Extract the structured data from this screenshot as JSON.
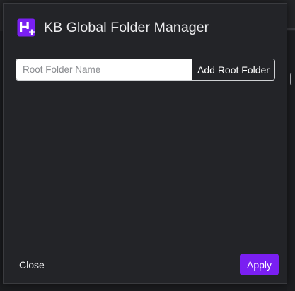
{
  "dialog": {
    "title": "KB Global Folder Manager",
    "logo_icon": "h-plus-logo-icon"
  },
  "form": {
    "root_folder_placeholder": "Root Folder Name",
    "root_folder_value": "",
    "add_root_folder_label": "Add Root Folder"
  },
  "footer": {
    "close_label": "Close",
    "apply_label": "Apply"
  },
  "colors": {
    "accent": "#7a1ff2",
    "modal_background": "#232428",
    "text": "#ececee"
  }
}
